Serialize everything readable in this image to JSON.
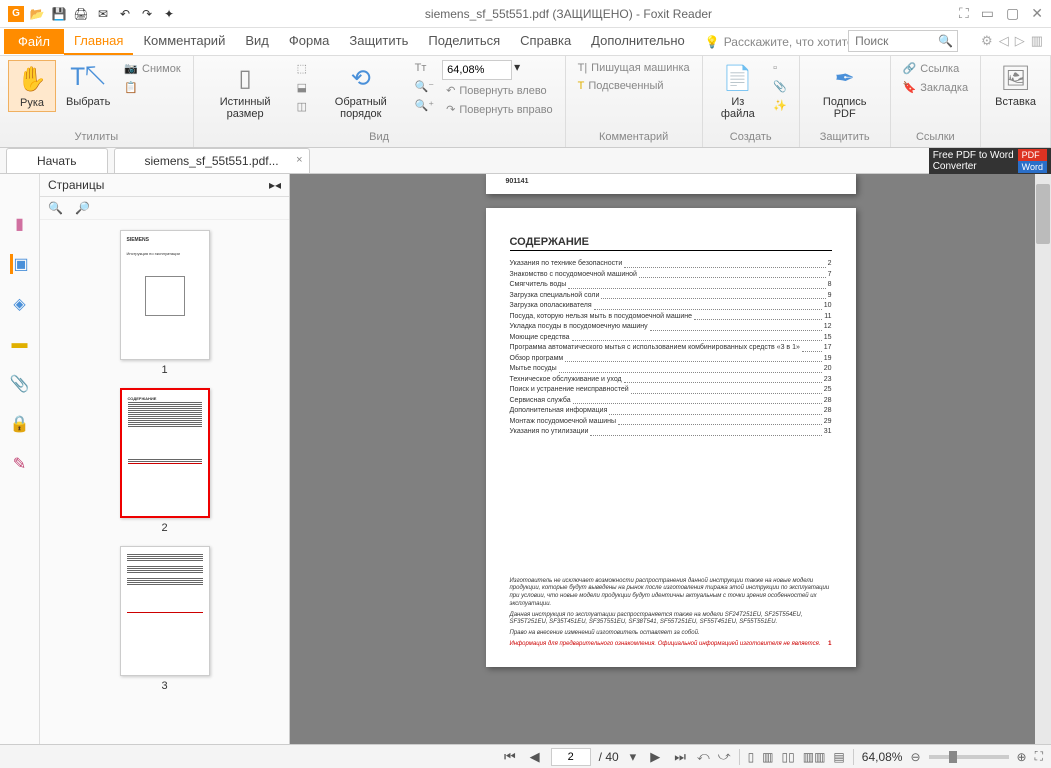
{
  "window": {
    "title": "siemens_sf_55t551.pdf (ЗАЩИЩЕНО) - Foxit Reader",
    "app_icon": "G"
  },
  "menu": {
    "file": "Файл",
    "tabs": [
      "Главная",
      "Комментарий",
      "Вид",
      "Форма",
      "Защитить",
      "Поделиться",
      "Справка",
      "Дополнительно"
    ],
    "tell_me": "Расскажите, что хотите",
    "search_placeholder": "Поиск"
  },
  "ribbon": {
    "groups": {
      "utilities": {
        "label": "Утилиты",
        "hand": "Рука",
        "select": "Выбрать",
        "snapshot": "Снимок"
      },
      "view": {
        "label": "Вид",
        "actual": "Истинный размер",
        "reverse": "Обратный порядок",
        "zoom_value": "64,08%",
        "rotate_left": "Повернуть влево",
        "rotate_right": "Повернуть вправо"
      },
      "comment": {
        "label": "Комментарий",
        "typewriter": "Пишущая машинка",
        "highlight": "Подсвеченный"
      },
      "create": {
        "label": "Создать",
        "from_file": "Из файла"
      },
      "protect": {
        "label": "Защитить",
        "sign": "Подпись PDF"
      },
      "links": {
        "label": "Ссылки",
        "link": "Ссылка",
        "bookmark": "Закладка"
      },
      "insert": {
        "label": "Вставка"
      }
    }
  },
  "doctabs": {
    "start": "Начать",
    "doc": "siemens_sf_55t551.pdf..."
  },
  "ad": {
    "text1": "Free PDF to Word",
    "text2": "Converter",
    "pdf": "PDF",
    "word": "Word"
  },
  "panel": {
    "title": "Страницы",
    "pages": [
      "1",
      "2",
      "3"
    ]
  },
  "page_peek": "901141",
  "toc": {
    "heading": "СОДЕРЖАНИЕ",
    "items": [
      {
        "t": "Указания по технике безопасности",
        "p": "2"
      },
      {
        "t": "Знакомство с посудомоечной машиной",
        "p": "7"
      },
      {
        "t": "Смягчитель воды",
        "p": "8"
      },
      {
        "t": "Загрузка специальной соли",
        "p": "9"
      },
      {
        "t": "Загрузка ополаскивателя",
        "p": "10"
      },
      {
        "t": "Посуда, которую нельзя мыть в посудомоечной машине",
        "p": "11"
      },
      {
        "t": "Укладка посуды в посудомоечную машину",
        "p": "12"
      },
      {
        "t": "Моющие средства",
        "p": "15"
      },
      {
        "t": "Программа автоматического мытья с использованием комбинированных средств «3 в 1»",
        "p": "17"
      },
      {
        "t": "Обзор программ",
        "p": "19"
      },
      {
        "t": "Мытье посуды",
        "p": "20"
      },
      {
        "t": "Техническое обслуживание и уход",
        "p": "23"
      },
      {
        "t": "Поиск и устранение неисправностей",
        "p": "25"
      },
      {
        "t": "Сервисная служба",
        "p": "28"
      },
      {
        "t": "Дополнительная информация",
        "p": "28"
      },
      {
        "t": "Монтаж посудомоечной машины",
        "p": "29"
      },
      {
        "t": "Указания по утилизации",
        "p": "31"
      }
    ]
  },
  "disclaimer": {
    "p1": "Изготовитель не исключает возможности распространения данной инструкции также на новые модели продукции, которые будут выведены на рынок после изготовления тиража этой инструкции по эксплуатации при условии, что новые модели продукции будут идентичны актуальным с точки зрения особенностей их эксплуатации.",
    "p2": "Данная инструкция по эксплуатации распространяется также на модели SF24T251EU, SF25T554EU, SF35T251EU, SF35T451EU, SF35T551EU, SF38T541, SF55T251EU, SF55T451EU, SF55T551EU.",
    "p3": "Право на внесение изменений изготовитель оставляет за собой.",
    "red": "Информация для предварительного ознакомления. Официальной информацией изготовителя не является.",
    "red_page": "1"
  },
  "status": {
    "page_current": "2",
    "page_total": "/ 40",
    "zoom": "64,08%"
  }
}
